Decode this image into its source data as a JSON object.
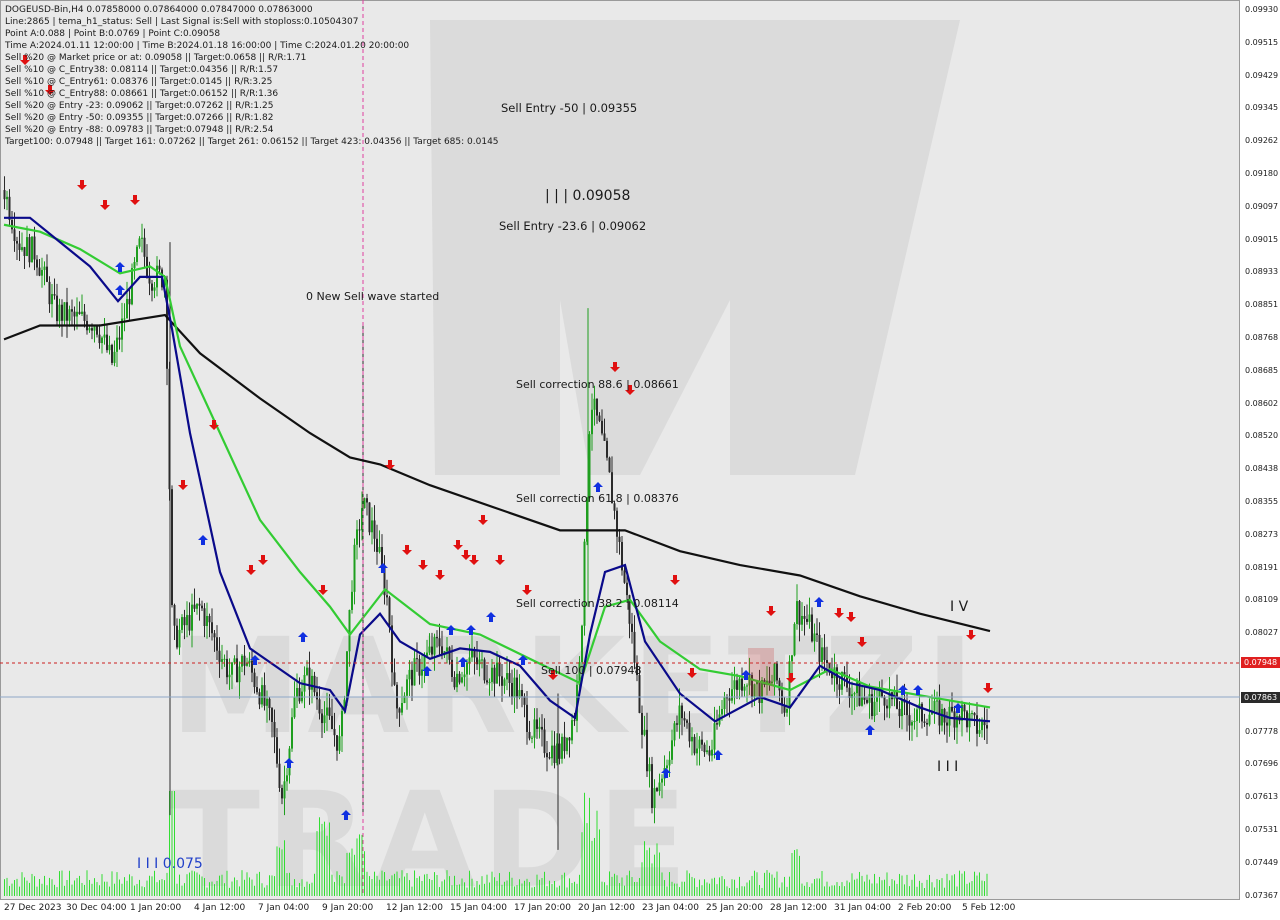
{
  "header": {
    "symbol_line": "DOGEUSD-Bin,H4  0.07858000 0.07864000 0.07847000 0.07863000",
    "info_lines": [
      "Line:2865 | tema_h1_status: Sell | Last Signal is:Sell with stoploss:0.10504307",
      "Point A:0.088 | Point B:0.0769 | Point C:0.09058",
      "Time A:2024.01.11 12:00:00 | Time B:2024.01.18 16:00:00 | Time C:2024.01.20 20:00:00",
      "Sell %20 @ Market price or at: 0.09058 || Target:0.0658 || R/R:1.71",
      "Sell %10 @ C_Entry38: 0.08114 || Target:0.04356 || R/R:1.57",
      "Sell %10 @ C_Entry61: 0.08376 || Target:0.0145 || R/R:3.25",
      "Sell %10 @ C_Entry88: 0.08661 || Target:0.06152 || R/R:1.36",
      "Sell %20 @ Entry -23: 0.09062 || Target:0.07262 || R/R:1.25",
      "Sell %20 @ Entry -50: 0.09355 || Target:0.07266 || R/R:1.82",
      "Sell %20 @ Entry -88: 0.09783 || Target:0.07948 || R/R:2.54",
      "Target100: 0.07948 || Target 161: 0.07262 || Target 261: 0.06152 || Target 423: 0.04356 || Target 685: 0.0145"
    ]
  },
  "annotations": {
    "sell_entry_50": "Sell Entry -50 | 0.09355",
    "wave_label_c": "| | | 0.09058",
    "sell_entry_23": "Sell Entry -23.6 | 0.09062",
    "new_wave": "0 New Sell wave started",
    "sell_corr_88": "Sell correction 88.6 | 0.08661",
    "sell_corr_61": "Sell correction 61.8 | 0.08376",
    "sell_corr_38": "Sell correction 38.2 | 0.08114",
    "sell_100": "Sell 100 | 0.07948",
    "wave_iv": "I V",
    "wave_iii": "I I I",
    "wave_b": "I I I 0.075"
  },
  "watermark": "MARKETZI TRADE",
  "y_axis": {
    "ticks": [
      "0.09930",
      "0.09515",
      "0.09429",
      "0.09345",
      "0.09262",
      "0.09180",
      "0.09097",
      "0.09015",
      "0.08933",
      "0.08851",
      "0.08768",
      "0.08685",
      "0.08602",
      "0.08520",
      "0.08438",
      "0.08355",
      "0.08273",
      "0.08191",
      "0.08109",
      "0.08027",
      "0.07948",
      "0.07863",
      "0.07778",
      "0.07696",
      "0.07613",
      "0.07531",
      "0.07449",
      "0.07367"
    ],
    "price_tags": [
      {
        "label": "0.07948",
        "color": "#e02020"
      },
      {
        "label": "0.07863",
        "color": "#2a2a2a"
      }
    ]
  },
  "x_axis": {
    "ticks": [
      "27 Dec 2023",
      "30 Dec 04:00",
      "1 Jan 20:00",
      "4 Jan 12:00",
      "7 Jan 04:00",
      "9 Jan 20:00",
      "12 Jan 12:00",
      "15 Jan 04:00",
      "17 Jan 20:00",
      "20 Jan 12:00",
      "23 Jan 04:00",
      "25 Jan 20:00",
      "28 Jan 12:00",
      "31 Jan 04:00",
      "2 Feb 20:00",
      "5 Feb 12:00"
    ]
  },
  "colors": {
    "bull": "#1f9e1f",
    "bear": "#2b2b2b",
    "ma_fast": "#0a0a8a",
    "ma_mid": "#33cc33",
    "ma_slow": "#111111",
    "volume": "#33dd33",
    "sell_arrow": "#e01010",
    "buy_arrow": "#1030e0",
    "dotted_level": "#cc2020",
    "price_line": "#8fa8c8"
  },
  "chart_data": {
    "type": "candlestick",
    "symbol": "DOGEUSD-Bin",
    "timeframe": "H4",
    "y_range": [
      0.07367,
      0.0993
    ],
    "levels": {
      "target_100": 0.07948,
      "current": 0.07863
    },
    "approx_close_path": [
      {
        "t": "27 Dec 2023",
        "y": 0.093
      },
      {
        "t": "30 Dec 04:00",
        "y": 0.0905
      },
      {
        "t": "1 Jan 20:00",
        "y": 0.092
      },
      {
        "t": "4 Jan 12:00",
        "y": 0.083
      },
      {
        "t": "7 Jan 04:00",
        "y": 0.077
      },
      {
        "t": "9 Jan 20:00",
        "y": 0.084
      },
      {
        "t": "12 Jan 12:00",
        "y": 0.0805
      },
      {
        "t": "15 Jan 04:00",
        "y": 0.0812
      },
      {
        "t": "17 Jan 20:00",
        "y": 0.0778
      },
      {
        "t": "20 Jan 12:00",
        "y": 0.088
      },
      {
        "t": "23 Jan 04:00",
        "y": 0.0775
      },
      {
        "t": "25 Jan 20:00",
        "y": 0.08
      },
      {
        "t": "28 Jan 12:00",
        "y": 0.0815
      },
      {
        "t": "31 Jan 04:00",
        "y": 0.0795
      },
      {
        "t": "2 Feb 20:00",
        "y": 0.079
      },
      {
        "t": "5 Feb 12:00",
        "y": 0.07863
      }
    ]
  }
}
